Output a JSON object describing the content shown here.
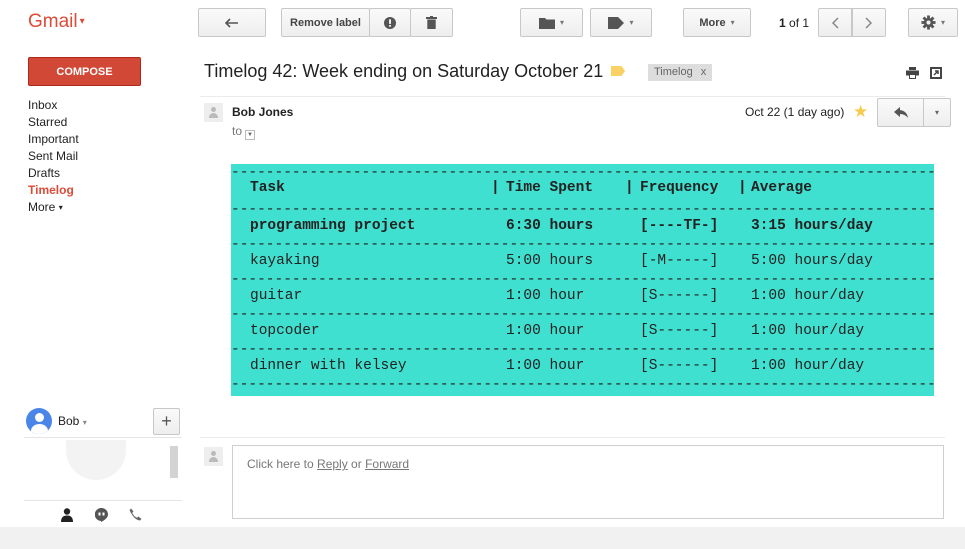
{
  "app": {
    "logo": "Gmail",
    "logo_caret": "▾"
  },
  "toolbar": {
    "remove_label": "Remove label",
    "more_label": "More",
    "dd_caret": "▾",
    "page_position": "1",
    "page_of": "of 1"
  },
  "sidebar": {
    "compose_label": "COMPOSE",
    "items": [
      {
        "label": "Inbox"
      },
      {
        "label": "Starred"
      },
      {
        "label": "Important"
      },
      {
        "label": "Sent Mail"
      },
      {
        "label": "Drafts"
      },
      {
        "label": "Timelog",
        "active": true
      },
      {
        "label": "More",
        "caret": "▾"
      }
    ]
  },
  "chat": {
    "user_name": "Bob",
    "caret": "▾",
    "add_label": "+"
  },
  "thread": {
    "subject": "Timelog 42: Week ending on Saturday October 21",
    "label_chip": "Timelog",
    "label_remove": "x",
    "label_color": "#fad165"
  },
  "message": {
    "sender": "Bob Jones",
    "to_label": "to",
    "date": "Oct 22 (1 day ago)",
    "star": "★"
  },
  "timelog": {
    "background": "#40e0d0",
    "dash_line": "----------------------------------------------------------------------------------------------------------",
    "headers": {
      "task": "Task",
      "sep1": "|",
      "time": "Time Spent",
      "sep2": "|",
      "freq": "Frequency",
      "sep3": "|",
      "avg": "Average"
    },
    "rows": [
      {
        "task": "programming project",
        "time": "6:30 hours",
        "freq": "[----TF-]",
        "avg": "3:15 hours/day",
        "bold": true
      },
      {
        "task": "kayaking",
        "time": "5:00 hours",
        "freq": "[-M-----]",
        "avg": "5:00 hours/day",
        "bold": false
      },
      {
        "task": "guitar",
        "time": "1:00 hour",
        "freq": "[S------]",
        "avg": "1:00 hour/day",
        "bold": false
      },
      {
        "task": "topcoder",
        "time": "1:00 hour",
        "freq": "[S------]",
        "avg": "1:00 hour/day",
        "bold": false
      },
      {
        "task": "dinner with kelsey",
        "time": "1:00 hour",
        "freq": "[S------]",
        "avg": "1:00 hour/day",
        "bold": false
      }
    ]
  },
  "reply": {
    "prefix": "Click here to ",
    "reply_link": "Reply",
    "middle": " or ",
    "forward_link": "Forward"
  }
}
